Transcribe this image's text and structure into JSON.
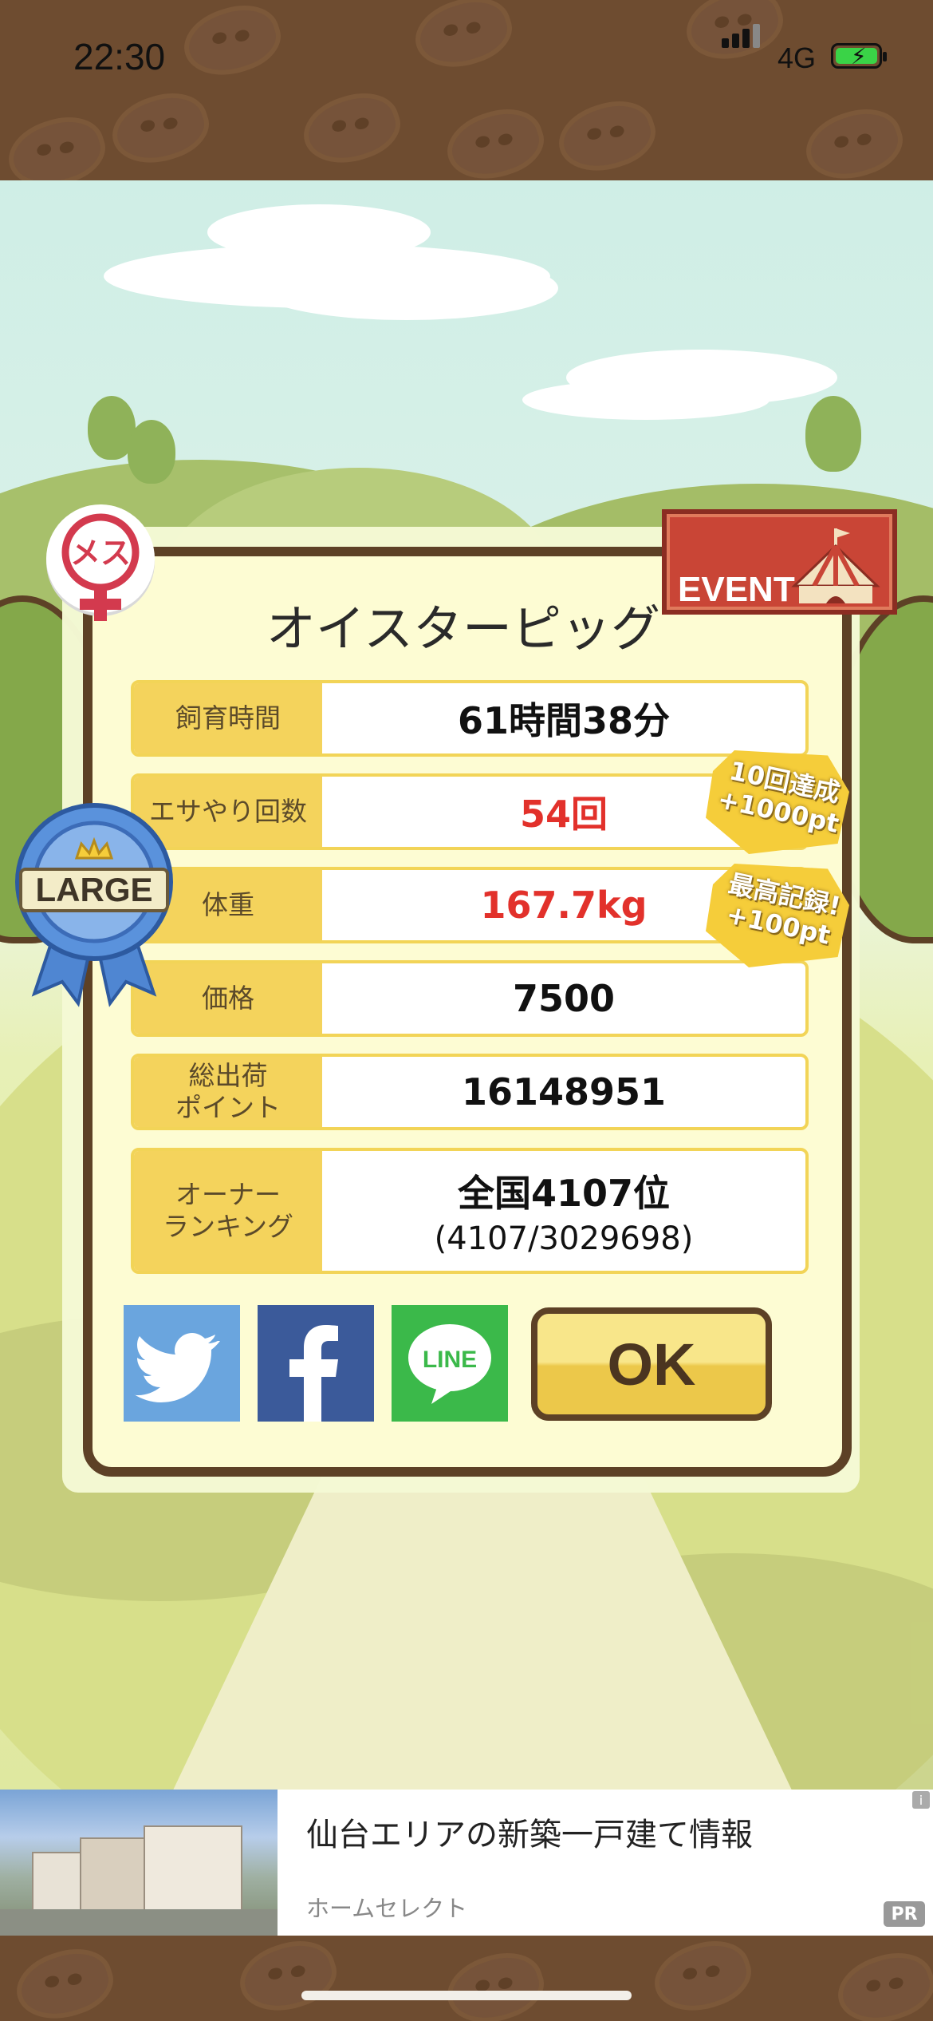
{
  "status": {
    "time": "22:30",
    "network": "4G"
  },
  "dialog": {
    "title": "オイスターピッグ",
    "rows": [
      {
        "label": "飼育時間",
        "value": "61時間38分"
      },
      {
        "label": "エサやり回数",
        "value": "54回"
      },
      {
        "label": "体重",
        "value": "167.7kg"
      },
      {
        "label": "価格",
        "value": "7500"
      },
      {
        "label": "総出荷\nポイント",
        "value": "16148951"
      }
    ],
    "ranking": {
      "label": "オーナー\nランキング",
      "line1": "全国4107位",
      "line2": "(4107/3029698)"
    },
    "ok_label": "OK"
  },
  "badges": {
    "female": "メス",
    "event": "EVENT",
    "large": "LARGE",
    "bonus1": "10回達成\n+1000pt",
    "bonus2": "最高記録!\n+100pt"
  },
  "share": {
    "line_label": "LINE",
    "facebook_glyph": "f"
  },
  "ad": {
    "title": "仙台エリアの新築一戸建て情報",
    "source": "ホームセレクト",
    "pr": "PR",
    "info": "i"
  },
  "colors": {
    "label_bg": "#f4d35c",
    "highlight_red": "#e2312b",
    "frame_brown": "#5d4126",
    "twitter": "#6aa5de",
    "facebook": "#3b5a9a",
    "line": "#3bb94a"
  },
  "icons": [
    "signal-icon",
    "battery-icon",
    "female-icon",
    "tent-icon",
    "crown-icon",
    "twitter-icon",
    "facebook-icon",
    "line-icon",
    "info-icon"
  ]
}
